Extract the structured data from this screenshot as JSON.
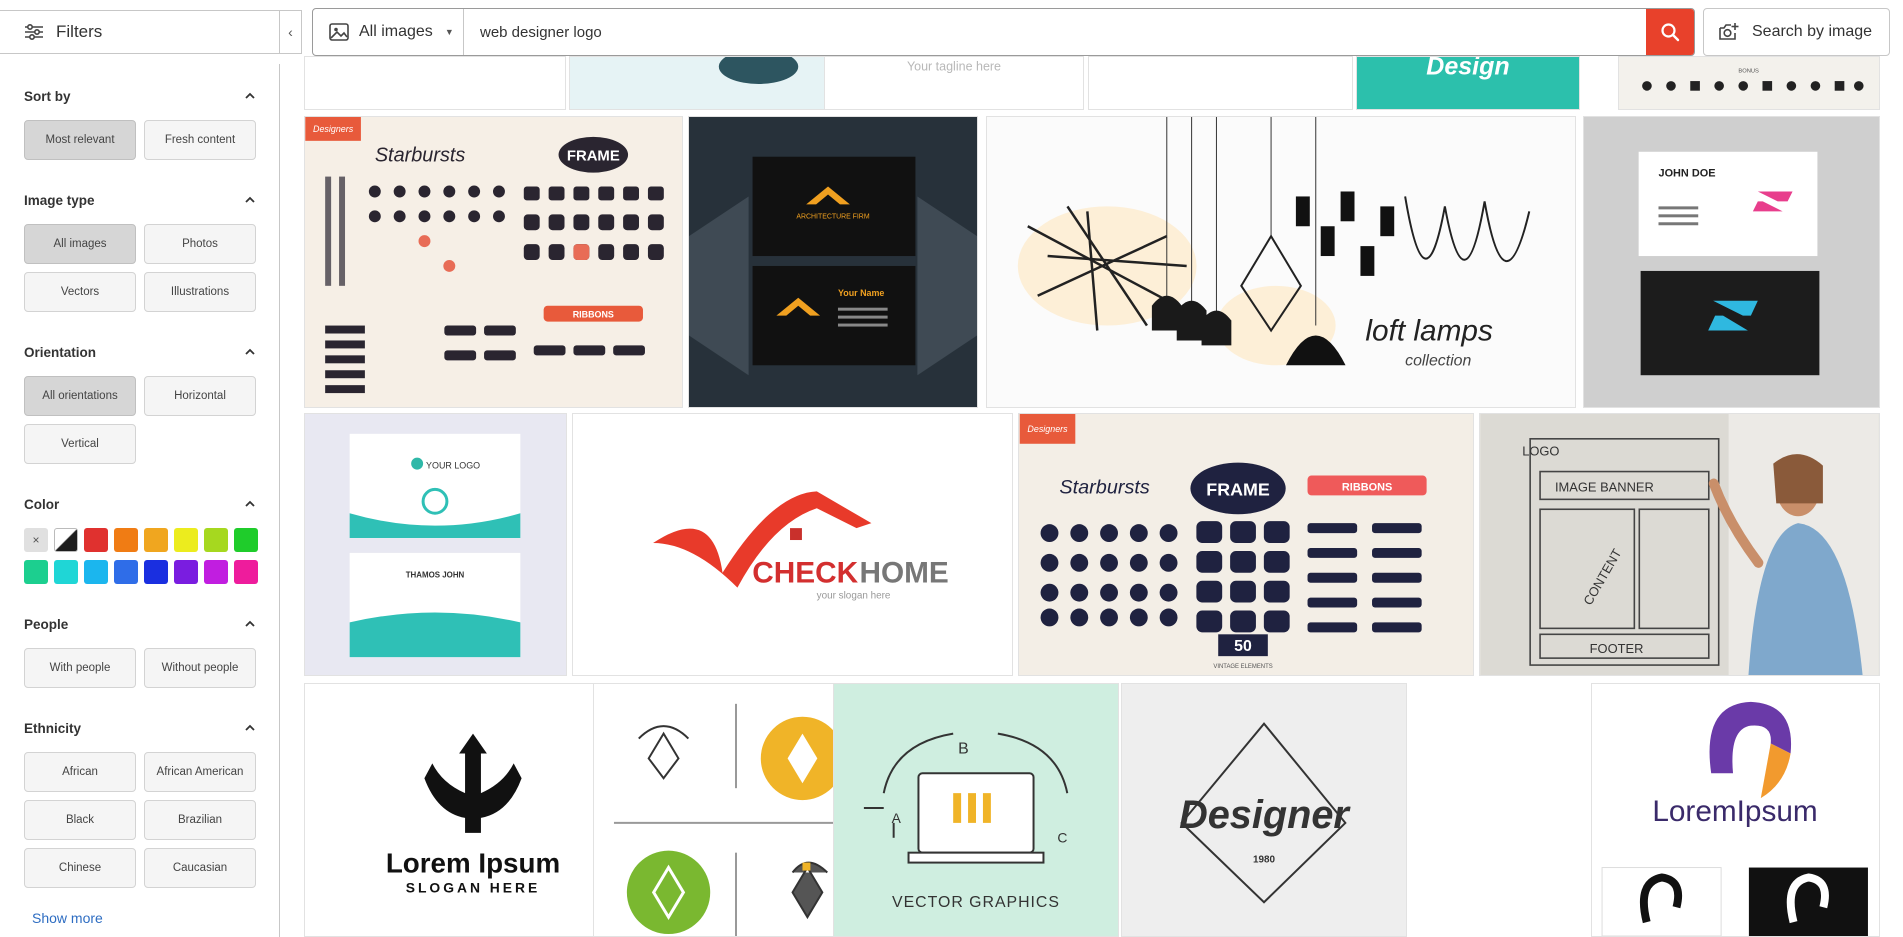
{
  "header": {
    "filters_label": "Filters",
    "collapse_glyph": "‹",
    "type_select": "All images",
    "search_value": "web designer logo",
    "search_by_image_label": "Search by image"
  },
  "sidebar": {
    "sort": {
      "title": "Sort by",
      "options": [
        "Most relevant",
        "Fresh content"
      ],
      "selected": "Most relevant"
    },
    "image_type": {
      "title": "Image type",
      "options": [
        "All images",
        "Photos",
        "Vectors",
        "Illustrations"
      ],
      "selected": "All images"
    },
    "orientation": {
      "title": "Orientation",
      "options": [
        "All orientations",
        "Horizontal",
        "Vertical"
      ],
      "selected": "All orientations"
    },
    "color": {
      "title": "Color",
      "clear_glyph": "×",
      "swatches": [
        "#000000-bw",
        "#e0312f",
        "#f07c14",
        "#f0a61f",
        "#ecec1e",
        "#a6d81f",
        "#1fcc2b",
        "#1ccf8f",
        "#1fd6d6",
        "#1bb6ee",
        "#2f6de8",
        "#1a2fe0",
        "#7a1de0",
        "#c11ee0",
        "#ee1c9c"
      ]
    },
    "people": {
      "title": "People",
      "options": [
        "With people",
        "Without people"
      ]
    },
    "ethnicity": {
      "title": "Ethnicity",
      "options": [
        "African",
        "African American",
        "Black",
        "Brazilian",
        "Chinese",
        "Caucasian"
      ]
    },
    "show_more": "Show more"
  },
  "results": {
    "tile_texts": {
      "tagline": "Your tagline here",
      "design": "Design",
      "bonus": "BONUS",
      "starbursts": "Starbursts",
      "frame": "FRAME",
      "ribbons": "RIBBONS",
      "designers": "Designers",
      "arch_firm": "ARCHITECTURE FIRM",
      "your_name": "Your Name",
      "loft": "loft lamps",
      "loft_sub": "collection",
      "john_doe": "JOHN DOE",
      "your_logo": "YOUR LOGO",
      "thamos": "THAMOS JOHN",
      "check": "CHECK",
      "home": "HOME",
      "slogan_small": "your slogan here",
      "fifty": "50",
      "vintage": "VINTAGE ELEMENTS",
      "logo": "LOGO",
      "image_banner": "IMAGE BANNER",
      "content": "CONTENT",
      "footer": "FOOTER",
      "lorem": "Lorem Ipsum",
      "slogan_here": "SLOGAN HERE",
      "vector_graphics": "VECTOR GRAPHICS",
      "designer_script": "Designer",
      "year": "1980",
      "loremipsum": "LoremIpsum"
    }
  }
}
